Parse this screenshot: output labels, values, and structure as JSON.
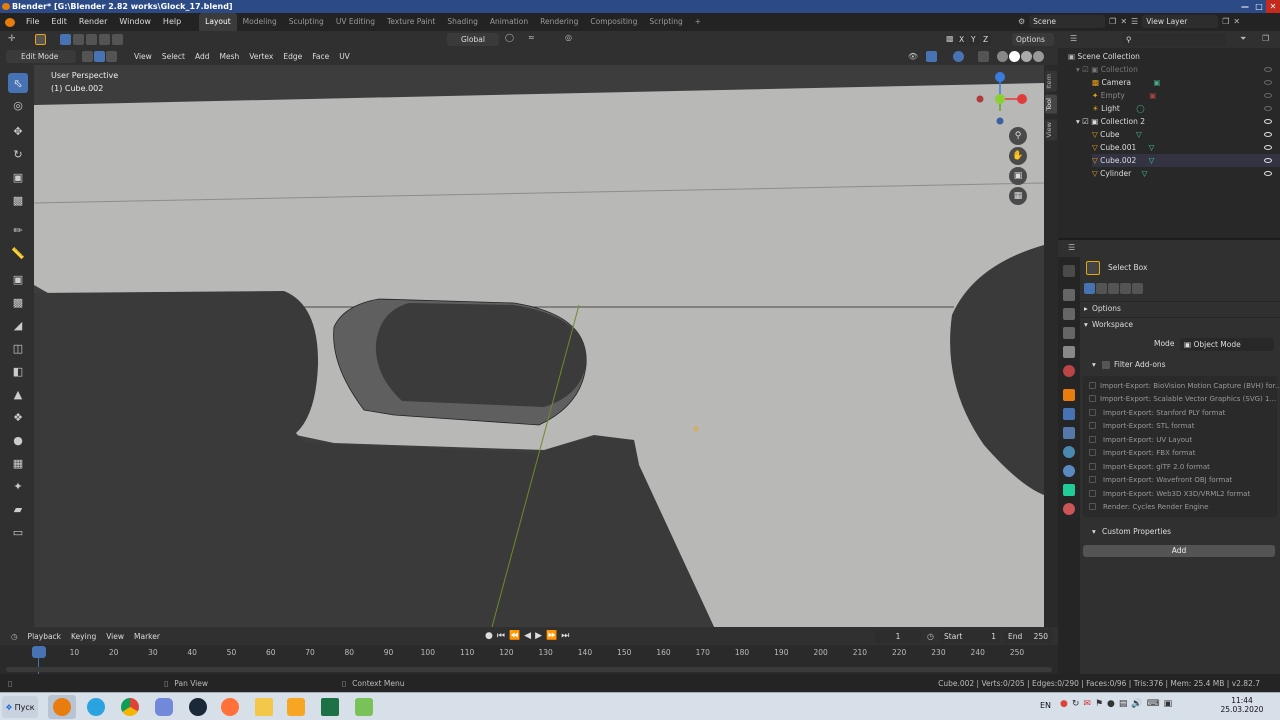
{
  "window": {
    "title": "Blender* [G:\\Blender 2.82 works\\Glock_17.blend]"
  },
  "menu": {
    "items": [
      "File",
      "Edit",
      "Render",
      "Window",
      "Help"
    ]
  },
  "workspaces": {
    "tabs": [
      "Layout",
      "Modeling",
      "Sculpting",
      "UV Editing",
      "Texture Paint",
      "Shading",
      "Animation",
      "Rendering",
      "Compositing",
      "Scripting"
    ],
    "active": "Layout",
    "add": "+"
  },
  "scene": {
    "name": "Scene",
    "view_layer": "View Layer"
  },
  "viewport": {
    "orientation": "Global",
    "options_label": "Options",
    "mode": "Edit Mode",
    "menus": [
      "View",
      "Select",
      "Add",
      "Mesh",
      "Vertex",
      "Edge",
      "Face",
      "UV"
    ],
    "perspective": "User Perspective",
    "object": "(1) Cube.002",
    "axes": [
      "X",
      "Y",
      "Z"
    ],
    "side_tabs": [
      "Item",
      "Tool",
      "View"
    ]
  },
  "outliner": {
    "search_placeholder": "",
    "items": [
      {
        "label": "Scene Collection",
        "level": 0,
        "icon": "collection"
      },
      {
        "label": "Collection",
        "level": 1,
        "icon": "collection",
        "dim": true
      },
      {
        "label": "Camera",
        "level": 2,
        "icon": "camera",
        "dim": true
      },
      {
        "label": "Empty",
        "level": 2,
        "icon": "empty",
        "dim": true
      },
      {
        "label": "Light",
        "level": 2,
        "icon": "light",
        "dim": true
      },
      {
        "label": "Collection 2",
        "level": 1,
        "icon": "collection"
      },
      {
        "label": "Cube",
        "level": 2,
        "icon": "mesh"
      },
      {
        "label": "Cube.001",
        "level": 2,
        "icon": "mesh"
      },
      {
        "label": "Cube.002",
        "level": 2,
        "icon": "mesh",
        "selected": true
      },
      {
        "label": "Cylinder",
        "level": 2,
        "icon": "mesh"
      }
    ]
  },
  "properties": {
    "tool_name": "Select Box",
    "options": "Options",
    "workspace": "Workspace",
    "mode_label": "Mode",
    "mode_value": "Object Mode",
    "filter_addons": "Filter Add-ons",
    "addons": [
      "Import-Export: BioVision Motion Capture (BVH) for...",
      "Import-Export: Scalable Vector Graphics (SVG) 1...",
      "Import-Export: Stanford PLY format",
      "Import-Export: STL format",
      "Import-Export: UV Layout",
      "Import-Export: FBX format",
      "Import-Export: glTF 2.0 format",
      "Import-Export: Wavefront OBJ format",
      "Import-Export: Web3D X3D/VRML2 format",
      "Render: Cycles Render Engine"
    ],
    "custom_properties": "Custom Properties",
    "add_button": "Add"
  },
  "timeline": {
    "menus": [
      "Playback",
      "Keying",
      "View",
      "Marker"
    ],
    "current_frame": "1",
    "start_label": "Start",
    "start": "1",
    "end_label": "End",
    "end": "250",
    "ticks": [
      "1",
      "10",
      "20",
      "30",
      "40",
      "50",
      "60",
      "70",
      "80",
      "90",
      "100",
      "110",
      "120",
      "130",
      "140",
      "150",
      "160",
      "170",
      "180",
      "190",
      "200",
      "210",
      "220",
      "230",
      "240",
      "250"
    ]
  },
  "status": {
    "left_hint": "Pan View",
    "mid_hint": "Context Menu",
    "stats": "Cube.002 | Verts:0/205 | Edges:0/290 | Faces:0/96 | Tris:376 | Mem: 25.4 MB | v2.82.7"
  },
  "taskbar": {
    "start": "Пуск",
    "lang": "EN",
    "time": "11:44",
    "date": "25.03.2020",
    "apps": [
      "blender",
      "telegram",
      "chrome",
      "discord",
      "steam",
      "firefox",
      "explorer",
      "media-player",
      "excel",
      "android"
    ]
  },
  "colors": {
    "accent": "#4772b3",
    "blender_orange": "#e87d0d",
    "bg": "#1d1d1d"
  }
}
